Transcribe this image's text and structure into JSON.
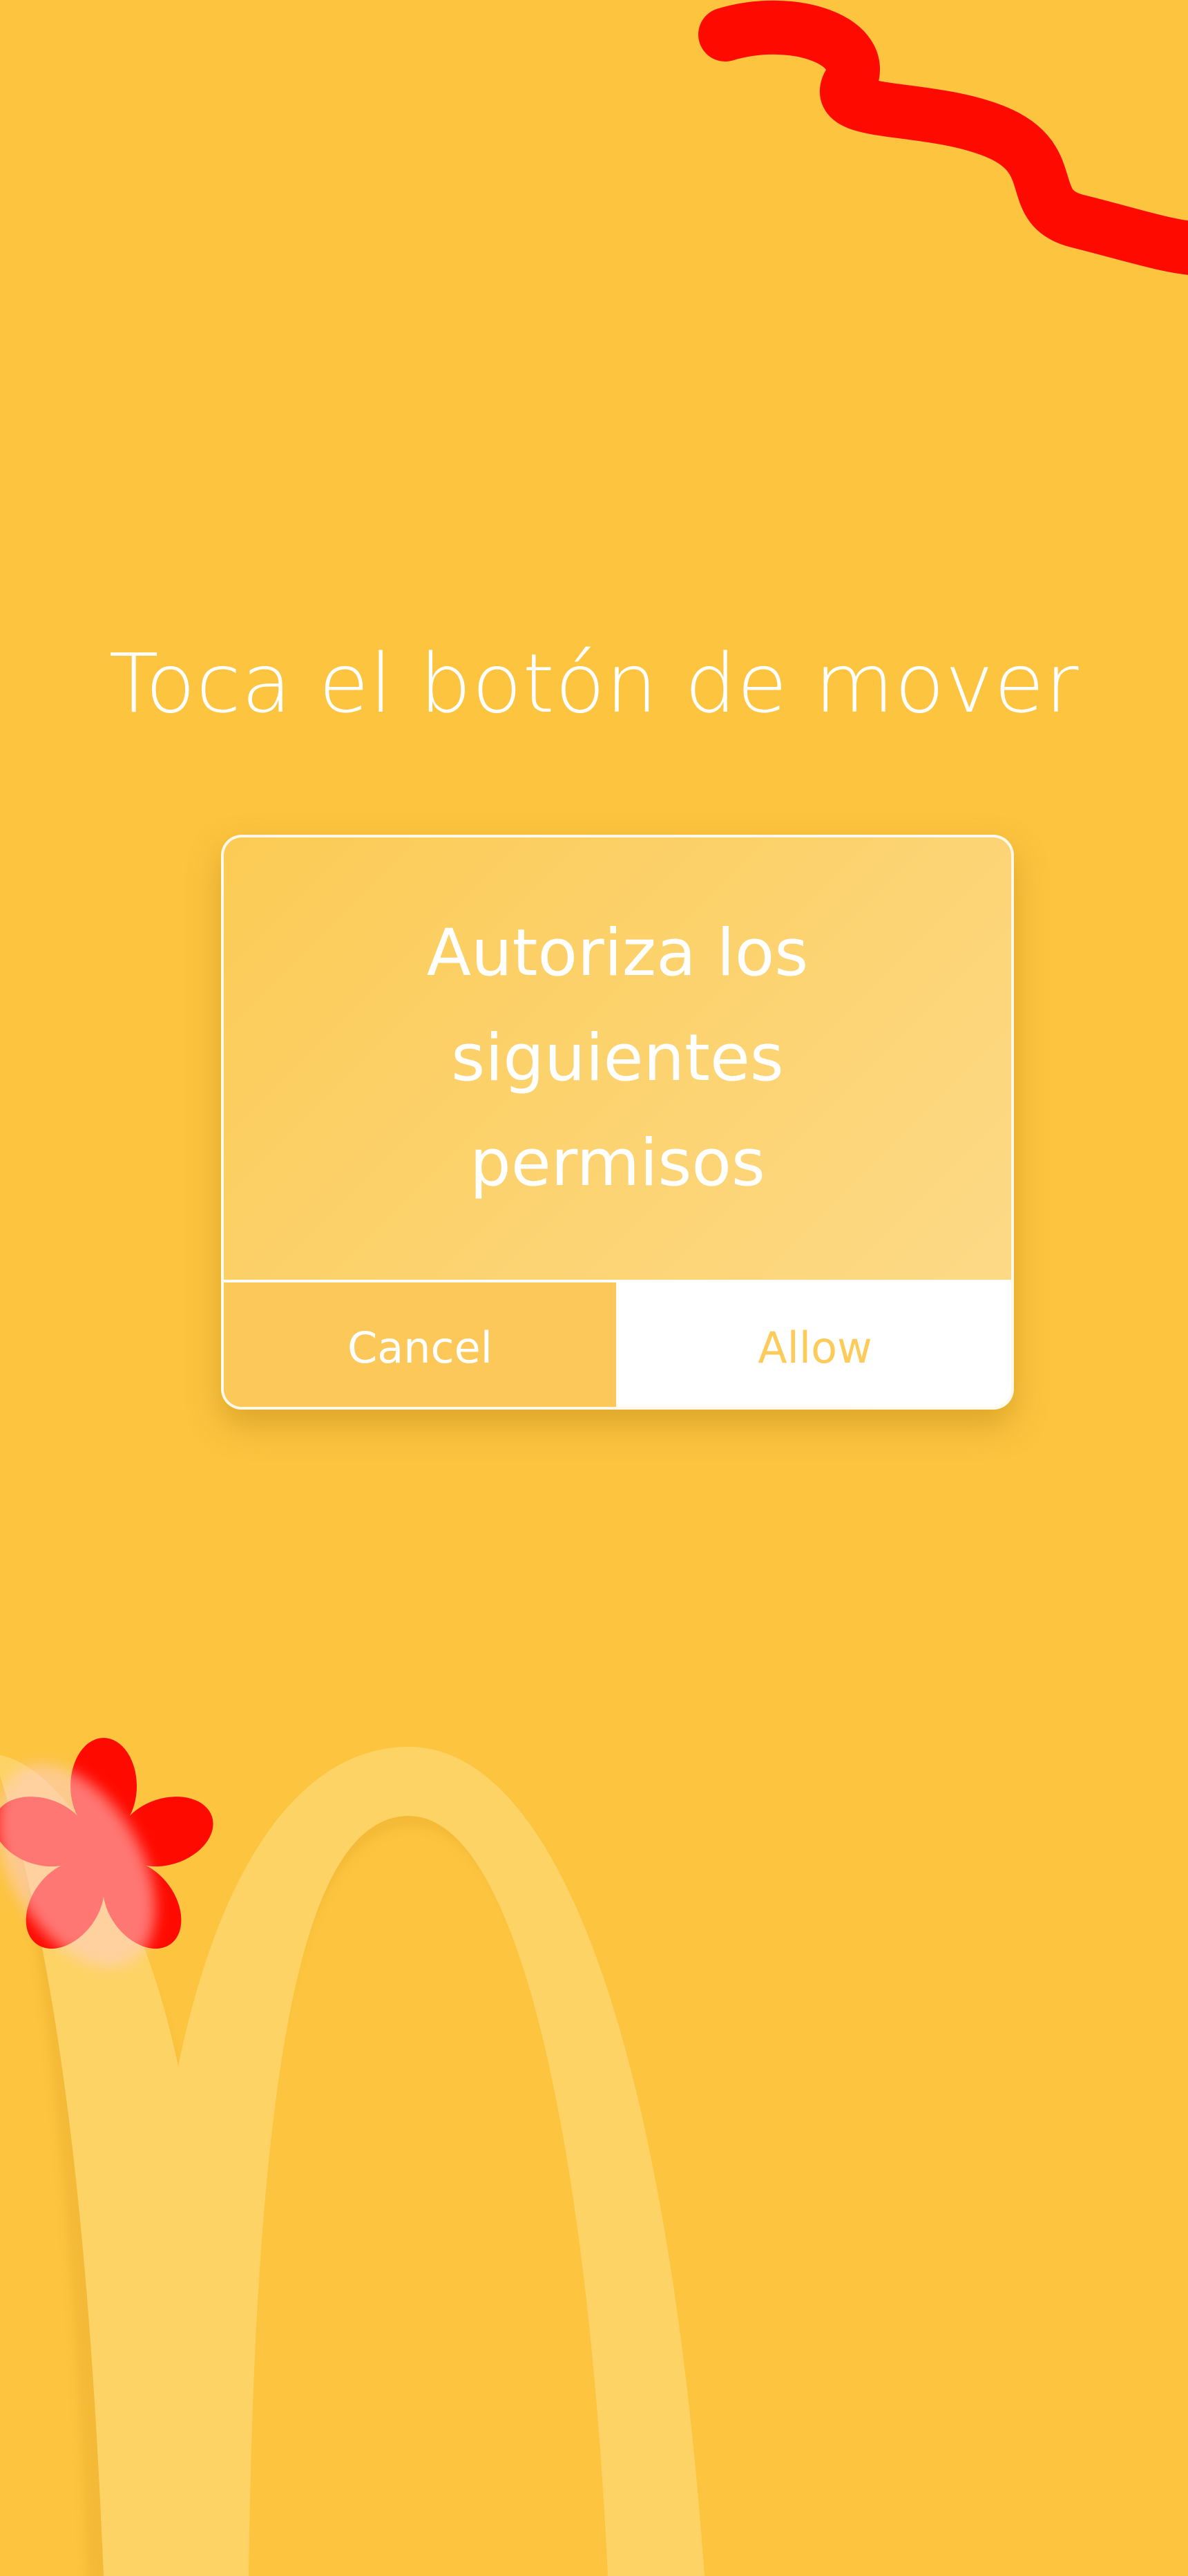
{
  "screen": {
    "instruction": "Toca el botón de mover"
  },
  "dialog": {
    "title": "Autoriza los siguientes permisos",
    "cancel_label": "Cancel",
    "allow_label": "Allow"
  },
  "colors": {
    "background": "#FCC43F",
    "accent_red": "#FF0000",
    "arch": "#FDD365",
    "dialog_fill": "#FCCB55",
    "allow_text": "#FCCB5A"
  },
  "icons": {
    "squiggle": "red-squiggle-icon",
    "flower": "red-flower-icon",
    "arches": "golden-arches-logo"
  }
}
